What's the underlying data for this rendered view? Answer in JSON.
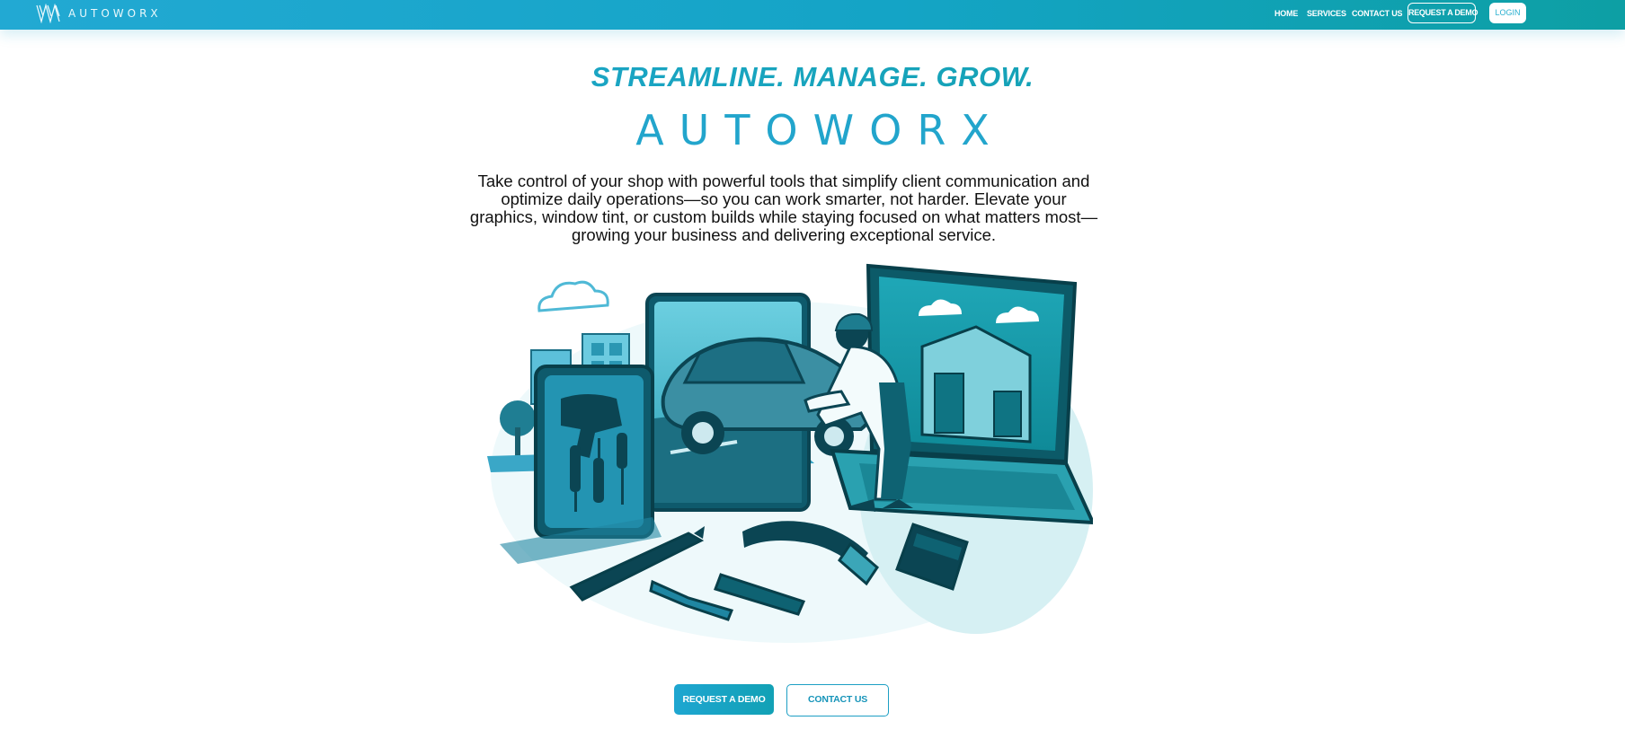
{
  "nav": {
    "logo_text": "AUTOWORX",
    "links": [
      "HOME",
      "SERVICES",
      "CONTACT US"
    ],
    "request_demo": "REQUEST A DEMO",
    "login": "LOGIN"
  },
  "hero": {
    "tagline": "STREAMLINE. MANAGE. GROW.",
    "brand": "AUTOWORX",
    "intro": "Take control of your shop with powerful tools that simplify client communication and optimize daily operations—so you can work smarter, not harder. Elevate your graphics, window tint, or custom builds while staying focused on what matters most—growing your business and delivering exceptional service.",
    "primary_cta": "REQUEST A DEMO",
    "secondary_cta": "CONTACT US"
  },
  "colors": {
    "brand_blue": "#22a9d3",
    "brand_teal": "#0d9fa4",
    "illustration_dark": "#0c5a68"
  },
  "icons": [
    "autoworx-logo-icon",
    "hero-illustration"
  ]
}
